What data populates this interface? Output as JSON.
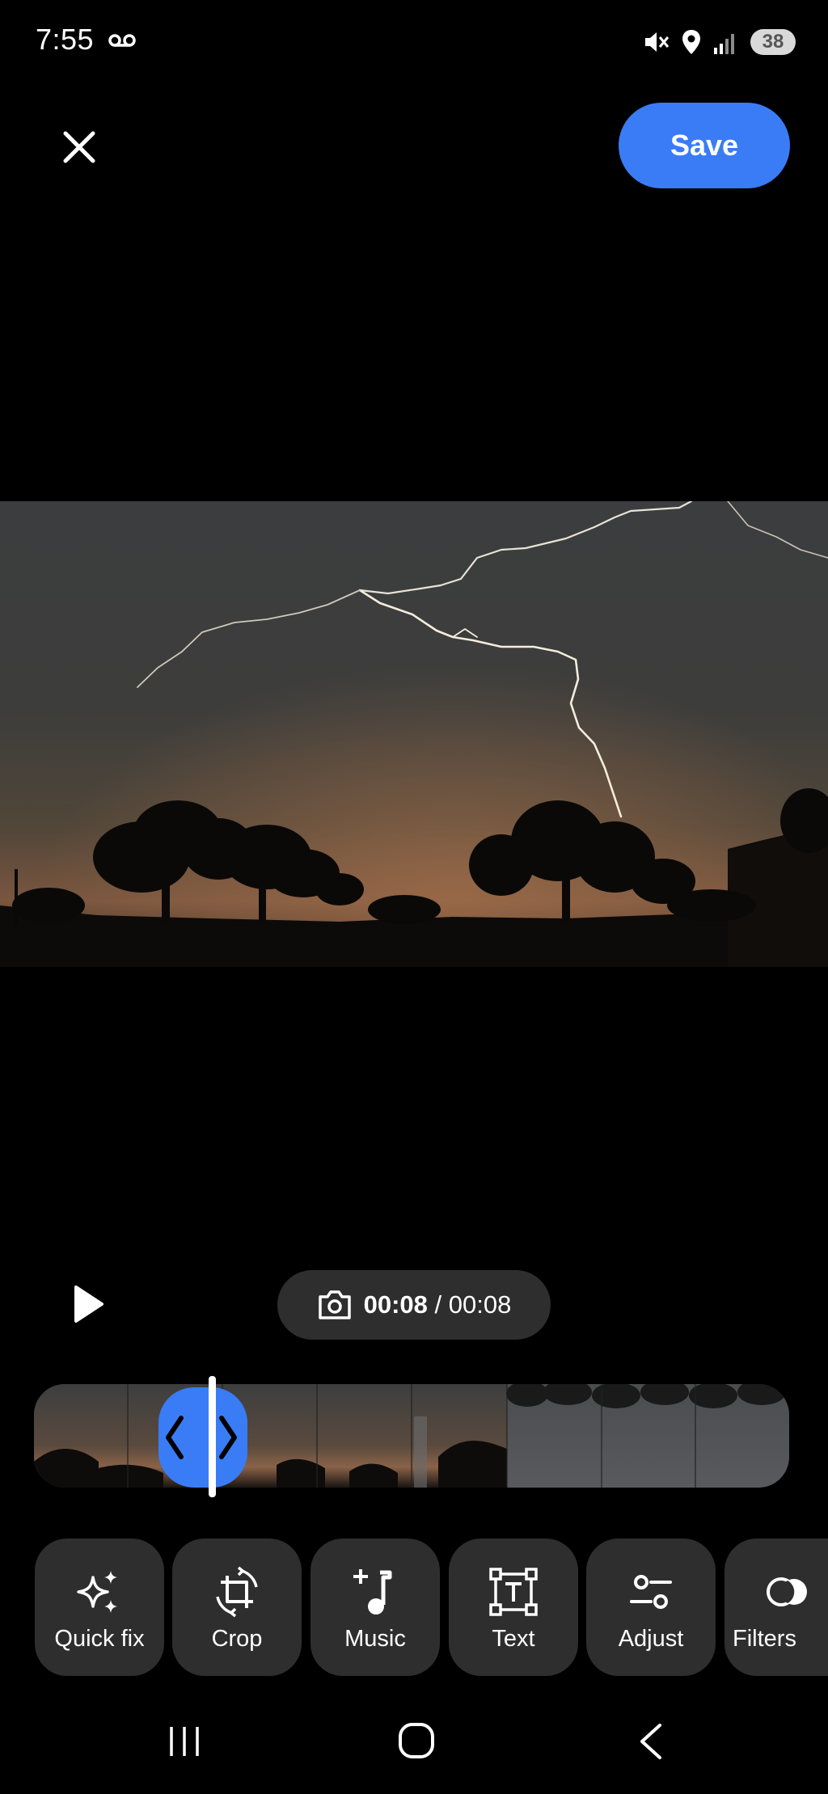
{
  "status_bar": {
    "time": "7:55",
    "battery": "38",
    "icons": [
      "voicemail-icon",
      "mute-icon",
      "location-icon",
      "signal-icon",
      "battery-icon"
    ]
  },
  "top_bar": {
    "save_label": "Save",
    "close_icon": "close-icon"
  },
  "preview": {
    "description_icon": "video-frame"
  },
  "playback": {
    "current_time": "00:08",
    "separator": "/",
    "total_time": "00:08",
    "play_icon": "play-icon",
    "snapshot_icon": "camera-icon"
  },
  "timeline": {
    "trim_left_icon": "chevron-left-icon",
    "trim_right_icon": "chevron-right-icon"
  },
  "tools": [
    {
      "label": "Quick fix",
      "icon": "sparkle-icon"
    },
    {
      "label": "Crop",
      "icon": "crop-rotate-icon"
    },
    {
      "label": "Music",
      "icon": "music-add-icon"
    },
    {
      "label": "Text",
      "icon": "text-box-icon"
    },
    {
      "label": "Adjust",
      "icon": "adjust-sliders-icon"
    },
    {
      "label": "Filters",
      "icon": "filters-icon"
    }
  ],
  "nav_bar": {
    "icons": [
      "recent-apps-icon",
      "home-icon",
      "back-icon"
    ]
  },
  "colors": {
    "accent": "#3a7cf6",
    "background": "#000000",
    "pill": "#2e2e2e"
  }
}
